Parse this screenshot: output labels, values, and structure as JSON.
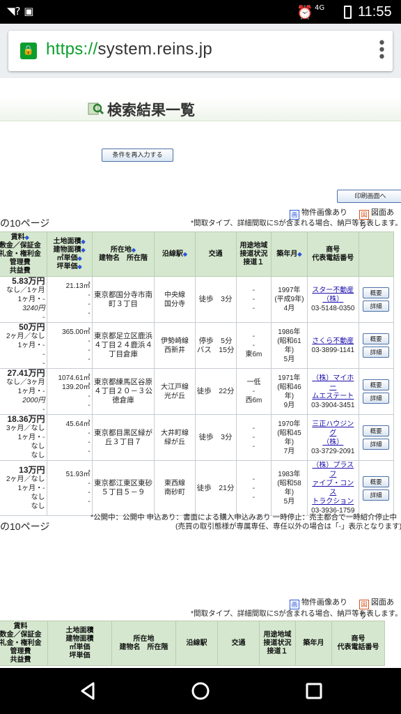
{
  "status": {
    "time": "11:55",
    "network": "4G"
  },
  "browser": {
    "url_scheme": "https://",
    "url_host": "system.reins.jp"
  },
  "page": {
    "title": "検索結果一覧",
    "re_enter_button": "条件を再入力する",
    "print_button": "印刷画面へ",
    "legend": {
      "photo": "物件画像あり",
      "plan": "図面あり"
    },
    "note_top": "*間取タイプ、詳細間取にSが含まれる場合、納戸等を表します。",
    "page_label": "の10ページ",
    "headers": {
      "rent": [
        "賃料",
        "敷金／保証金",
        "礼金・権利金",
        "管理費",
        "共益費"
      ],
      "rent_top": [
        "賃料",
        "数金／保証金",
        "礼金・権利金",
        "管理費",
        "共益費"
      ],
      "area": [
        "土地面積",
        "建物面積",
        "㎡単価",
        "坪単価"
      ],
      "addr": [
        "所在地",
        "建物名　所在階"
      ],
      "line": "沿線駅",
      "traffic": "交通",
      "zone": [
        "用途地域",
        "接道状況",
        "接道１"
      ],
      "built": "築年月",
      "company": [
        "商号",
        "代表電話番号"
      ]
    },
    "rows": [
      {
        "rent": "5.83万円",
        "rent_sub": [
          "なし／1ヶ月",
          "1ヶ月・-",
          "3240円",
          "-"
        ],
        "area": [
          "21.13㎡",
          "-",
          "-",
          "-"
        ],
        "addr": "東京都国分寺市南町３丁目",
        "line": [
          "中央線",
          "国分寺"
        ],
        "traffic": "徒歩　3分",
        "zone": [
          "-",
          "-",
          "-"
        ],
        "built": [
          "1997年",
          "(平成9年)",
          "4月"
        ],
        "company": [
          "スター不動産",
          "（株）"
        ],
        "phone": "03-5148-0350"
      },
      {
        "rent": "50万円",
        "rent_sub": [
          "2ヶ月／なし",
          "1ヶ月・-",
          "-",
          "-"
        ],
        "area": [
          "365.00㎡",
          "-",
          "-",
          "-"
        ],
        "addr": "東京都足立区鹿浜４丁目２４鹿浜４丁目倉庫",
        "line": [
          "伊勢崎線",
          "西新井"
        ],
        "traffic": "停歩　5分\nバス　15分",
        "zone": [
          "-",
          "-",
          "東6m"
        ],
        "built": [
          "1986年",
          "(昭和61年)",
          "5月"
        ],
        "company": [
          "さくら不動産"
        ],
        "phone": "03-3899-1141"
      },
      {
        "rent": "27.41万円",
        "rent_sub": [
          "なし／3ヶ月",
          "1ヶ月・-",
          "2000円",
          "-"
        ],
        "area": [
          "1074.61㎡",
          "139.20㎡",
          "-",
          "-"
        ],
        "addr": "東京都練馬区谷原４丁目２０－３公徳倉庫",
        "line": [
          "大江戸線",
          "光が丘"
        ],
        "traffic": "徒歩　22分",
        "zone": [
          "一低",
          "-",
          "西6m"
        ],
        "built": [
          "1971年",
          "(昭和46年)",
          "9月"
        ],
        "company": [
          "（株）マイホー",
          "ムエステート"
        ],
        "phone": "03-3904-3451"
      },
      {
        "rent": "18.36万円",
        "rent_sub": [
          "3ヶ月／なし",
          "1ヶ月・-",
          "なし",
          "なし"
        ],
        "area": [
          "45.64㎡",
          "-",
          "-",
          "-"
        ],
        "addr": "東京都目黒区緑が丘３丁目７",
        "line": [
          "大井町線",
          "緑が丘"
        ],
        "traffic": "徒歩　3分",
        "zone": [
          "-",
          "-",
          "-"
        ],
        "built": [
          "1970年",
          "(昭和45年)",
          "7月"
        ],
        "company": [
          "三正ハウジング",
          "（株）"
        ],
        "phone": "03-3729-2091"
      },
      {
        "rent": "13万円",
        "rent_sub": [
          "2ヶ月／なし",
          "1ヶ月・-",
          "なし",
          "なし"
        ],
        "area": [
          "51.93㎡",
          "-",
          "-",
          "-"
        ],
        "addr": "東京都江東区東砂５丁目５－９",
        "line": [
          "東西線",
          "南砂町"
        ],
        "traffic": "徒歩　21分",
        "zone": [
          "-",
          "-",
          "-"
        ],
        "built": [
          "1983年",
          "(昭和58年)",
          "5月"
        ],
        "company": [
          "（株）プラスフ",
          "ァイブ・コンス",
          "トラクション"
        ],
        "phone": "03-3936-1759"
      }
    ],
    "btn_summary": "概要",
    "btn_detail": "詳細",
    "foot_note1": "*公開中：公開中 申込あり：書面による購入申込みあり 一時停止：売主都合で一時紹介停止中",
    "foot_note2": "(売買の取引態様が専属専任、専任以外の場合は「-」表示となります)"
  }
}
